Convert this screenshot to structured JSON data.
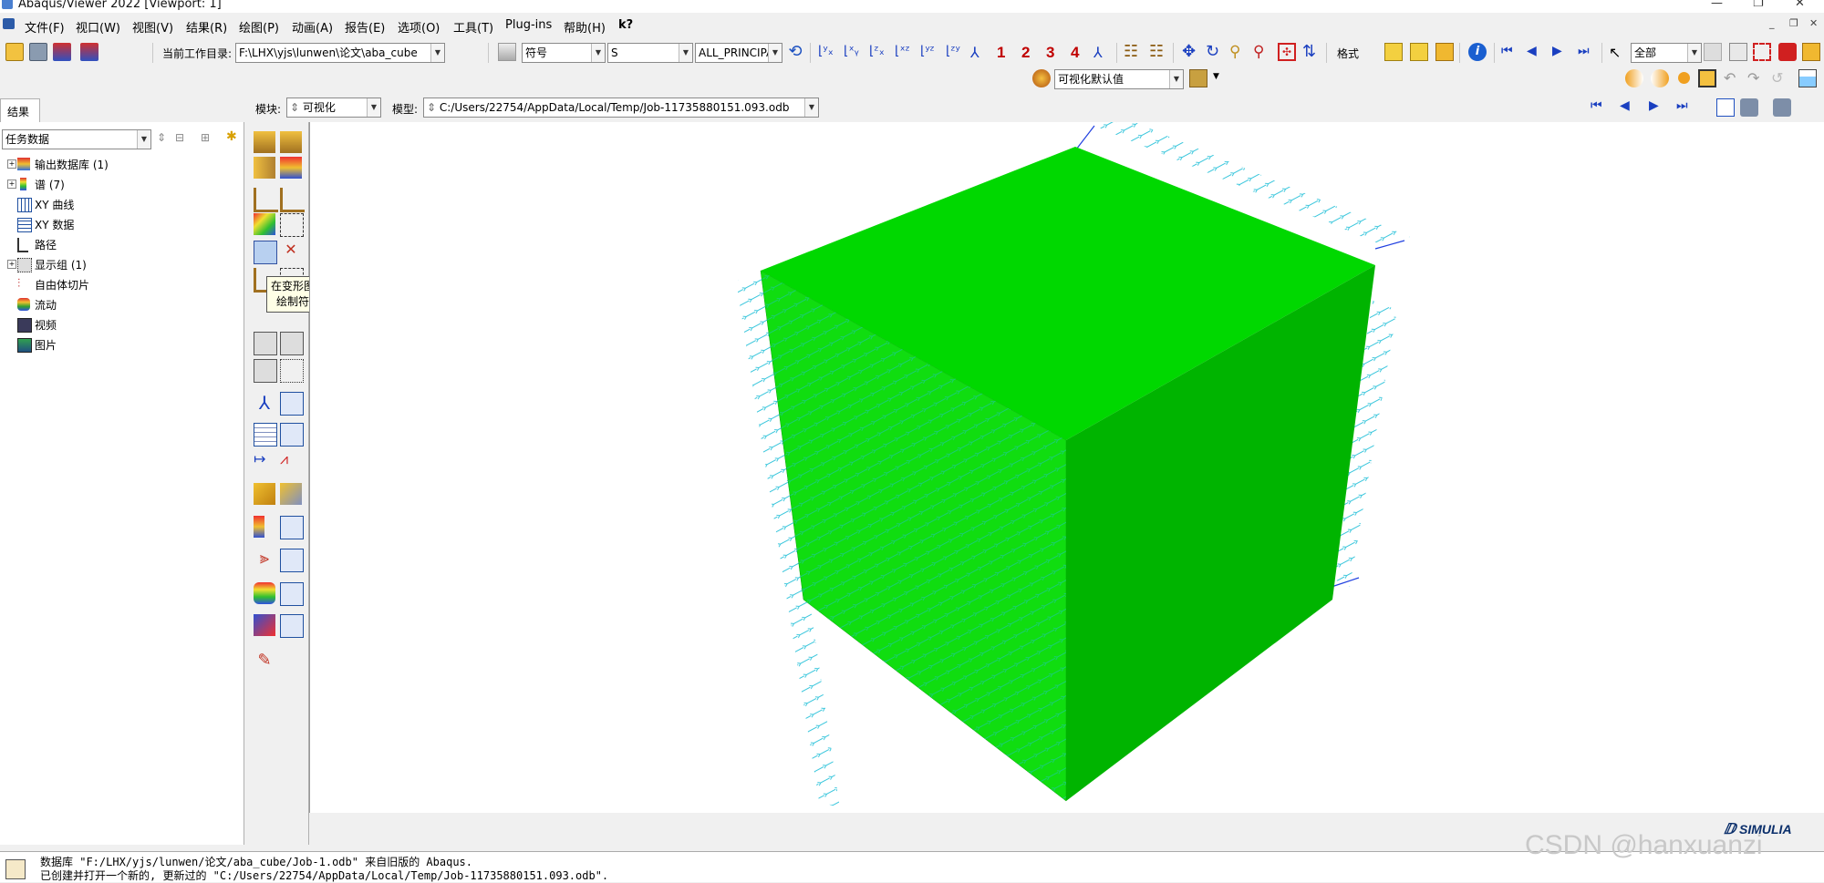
{
  "window": {
    "title": "Abaqus/Viewer 2022 [Viewport: 1]"
  },
  "menus": [
    "文件(F)",
    "视口(W)",
    "视图(V)",
    "结果(R)",
    "绘图(P)",
    "动画(A)",
    "报告(E)",
    "选项(O)",
    "工具(T)",
    "Plug-ins",
    "帮助(H)",
    "k?"
  ],
  "toolbar": {
    "workdir_label": "当前工作目录:",
    "workdir_value": "F:\\LHX\\yjs\\lunwen\\论文\\aba_cube",
    "plot_type": "符号",
    "variable": "S",
    "component": "ALL_PRINCIPAL",
    "numbers": [
      "1",
      "2",
      "3",
      "4"
    ],
    "format_label": "格式",
    "display_all": "全部",
    "viz_defaults": "可视化默认值"
  },
  "context": {
    "module_label": "模块:",
    "module_value": "可视化",
    "model_label": "模型:",
    "model_value": "C:/Users/22754/AppData/Local/Temp/Job-11735880151.093.odb"
  },
  "tree": {
    "tab": "结果",
    "filter": "任务数据",
    "items": [
      {
        "label": "输出数据库 (1)",
        "expandable": true,
        "icon": "odb-icon"
      },
      {
        "label": "谱 (7)",
        "expandable": true,
        "icon": "spectrum-icon"
      },
      {
        "label": "XY 曲线",
        "expandable": false,
        "icon": "xy-plot-icon"
      },
      {
        "label": "XY 数据",
        "expandable": false,
        "icon": "xy-data-icon"
      },
      {
        "label": "路径",
        "expandable": false,
        "icon": "path-icon"
      },
      {
        "label": "显示组 (1)",
        "expandable": true,
        "icon": "display-group-icon"
      },
      {
        "label": "自由体切片",
        "expandable": false,
        "icon": "free-body-icon"
      },
      {
        "label": "流动",
        "expandable": false,
        "icon": "stream-icon"
      },
      {
        "label": "视频",
        "expandable": false,
        "icon": "movie-icon"
      },
      {
        "label": "图片",
        "expandable": false,
        "icon": "image-icon"
      }
    ]
  },
  "tooltip": {
    "line1": "在变形图上",
    "line2": "绘制符号"
  },
  "messages": [
    "数据库 \"F:/LHX/yjs/lunwen/论文/aba_cube/Job-1.odb\" 来自旧版的 Abaqus.",
    "已创建并打开一个新的, 更新过的 \"C:/Users/22754/AppData/Local/Temp/Job-11735880151.093.odb\"."
  ],
  "brand": "SIMULIA",
  "watermark": "CSDN @hanxuanzi",
  "colors": {
    "cube_top": "#00d800",
    "cube_right": "#00b400",
    "cube_front": "#11dd11",
    "arrow": "#22c0d8",
    "arrow_dark": "#2040e0"
  }
}
